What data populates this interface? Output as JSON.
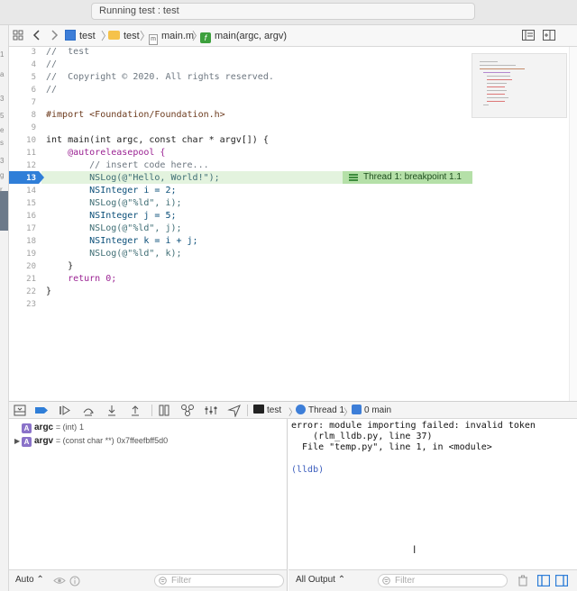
{
  "activity": {
    "status": "Running test : test"
  },
  "left_strip": {
    "letters": [
      "1",
      "a",
      "3",
      "5",
      "e",
      "s",
      "3",
      "g",
      "r"
    ]
  },
  "jumpbar": {
    "crumbs": [
      "test",
      "test",
      "main.m",
      "main(argc, argv)"
    ],
    "badge_m": "m",
    "badge_f": "f"
  },
  "editor": {
    "lines": [
      {
        "n": "3",
        "text": "//  test"
      },
      {
        "n": "4",
        "text": "//"
      },
      {
        "n": "5",
        "text": "//  Copyright © 2020. All rights reserved."
      },
      {
        "n": "6",
        "text": "//"
      },
      {
        "n": "7",
        "text": ""
      },
      {
        "n": "8",
        "text": "#import <Foundation/Foundation.h>"
      },
      {
        "n": "9",
        "text": ""
      },
      {
        "n": "10",
        "text": "int main(int argc, const char * argv[]) {"
      },
      {
        "n": "11",
        "text": "    @autoreleasepool {"
      },
      {
        "n": "12",
        "text": "        // insert code here..."
      },
      {
        "n": "13",
        "text": "        NSLog(@\"Hello, World!\");"
      },
      {
        "n": "14",
        "text": "        NSInteger i = 2;"
      },
      {
        "n": "15",
        "text": "        NSLog(@\"%ld\", i);"
      },
      {
        "n": "16",
        "text": "        NSInteger j = 5;"
      },
      {
        "n": "17",
        "text": "        NSLog(@\"%ld\", j);"
      },
      {
        "n": "18",
        "text": "        NSInteger k = i + j;"
      },
      {
        "n": "19",
        "text": "        NSLog(@\"%ld\", k);"
      },
      {
        "n": "20",
        "text": "    }"
      },
      {
        "n": "21",
        "text": "    return 0;"
      },
      {
        "n": "22",
        "text": "}"
      },
      {
        "n": "23",
        "text": ""
      }
    ],
    "breakpoint_line": "13",
    "thread_badge": "Thread 1: breakpoint 1.1"
  },
  "debugbar": {
    "process": "test",
    "thread": "Thread 1",
    "frame": "0 main"
  },
  "variables": [
    {
      "badge": "A",
      "name": "argc",
      "type": "= (int)",
      "value": "1",
      "expandable": false
    },
    {
      "badge": "A",
      "name": "argv",
      "type": "= (const char **)",
      "value": "0x7ffeefbff5d0",
      "expandable": true
    }
  ],
  "console": {
    "lines": [
      "error: module importing failed: invalid token",
      "    (rlm_lldb.py, line 37)",
      "  File \"temp.py\", line 1, in <module>",
      "",
      "(lldb)"
    ],
    "prompt_color": "#3b5dbd"
  },
  "bottom": {
    "var_scope": "Auto ⌃",
    "var_filter_placeholder": "Filter",
    "console_scope": "All Output ⌃",
    "console_filter_placeholder": "Filter"
  },
  "colors": {
    "breakpoint_blue": "#2f7ed8",
    "breakpoint_row": "#e3f3de",
    "thread_badge": "#b5e0a8",
    "variable_badge": "#8a72c9"
  }
}
